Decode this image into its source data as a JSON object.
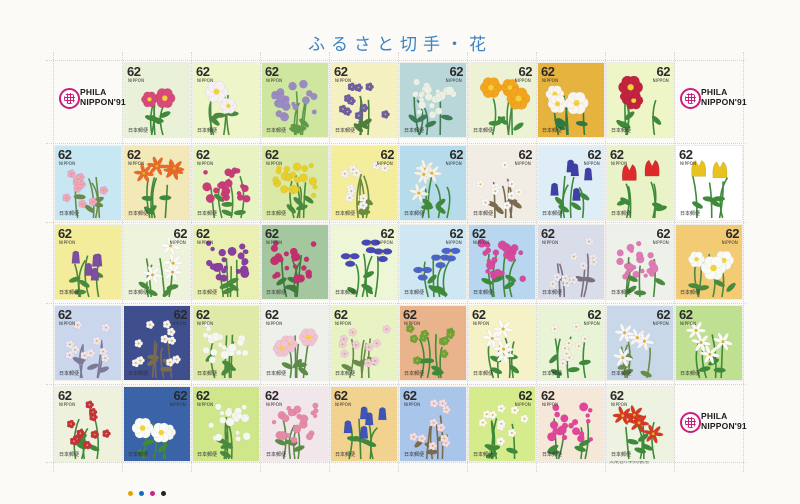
{
  "sheet": {
    "title": "ふるさと切手・花",
    "printer_note": "大蔵省印刷局製造",
    "registration_colors": [
      "#e0a600",
      "#0b6fc9",
      "#d0208a",
      "#222222"
    ]
  },
  "phila_labels": [
    {
      "line1": "PHILA",
      "line2": "NIPPON'91"
    },
    {
      "line1": "PHILA",
      "line2": "NIPPON'91"
    },
    {
      "line1": "PHILA",
      "line2": "NIPPON'91"
    }
  ],
  "stamp_common": {
    "denomination": "62",
    "nippon": "NIPPON",
    "post": "日本郵便"
  },
  "stamps": [
    {
      "bg": "#e9f2d8",
      "flower": "#d94a7b",
      "leaf": "#3f8a3a",
      "kind": "round",
      "dpos": "l"
    },
    {
      "bg": "#eef5c9",
      "flower": "#f6f0f2",
      "leaf": "#4a8a3e",
      "kind": "round",
      "dpos": "l"
    },
    {
      "bg": "#cfe6a0",
      "flower": "#9a8cc2",
      "leaf": "#5e9a48",
      "kind": "cluster",
      "dpos": "l"
    },
    {
      "bg": "#f4f0bf",
      "flower": "#6e5fa8",
      "leaf": "#4d7f3a",
      "kind": "spray",
      "dpos": "l"
    },
    {
      "bg": "#b9d7d8",
      "flower": "#eaf0e4",
      "leaf": "#3f7c53",
      "kind": "cluster",
      "dpos": "r"
    },
    {
      "bg": "#eef2d4",
      "flower": "#f3a51e",
      "leaf": "#3e8e3e",
      "kind": "round",
      "dpos": "r"
    },
    {
      "bg": "#e7b33f",
      "flower": "#fbf5ef",
      "leaf": "#2f7a40",
      "kind": "round",
      "dpos": "l"
    },
    {
      "bg": "#eef6c8",
      "flower": "#c4233e",
      "leaf": "#3f8a3a",
      "kind": "round",
      "dpos": "r"
    },
    {
      "bg": "#c7e7f2",
      "flower": "#f1a8c2",
      "leaf": "#6a8c4a",
      "kind": "spray",
      "dpos": "l"
    },
    {
      "bg": "#f3e8b7",
      "flower": "#ea6a2a",
      "leaf": "#3f8a3a",
      "kind": "star",
      "dpos": "l"
    },
    {
      "bg": "#e8f3c4",
      "flower": "#c93c78",
      "leaf": "#4a8a3e",
      "kind": "cluster",
      "dpos": "l"
    },
    {
      "bg": "#dbe9a6",
      "flower": "#e8cf2c",
      "leaf": "#4a8a3e",
      "kind": "cluster",
      "dpos": "l"
    },
    {
      "bg": "#f4ee9c",
      "flower": "#f7f4f6",
      "leaf": "#6b8a3e",
      "kind": "spray",
      "dpos": "r"
    },
    {
      "bg": "#b6dbeb",
      "flower": "#f3f2e8",
      "leaf": "#3f8a3a",
      "kind": "star",
      "dpos": "r"
    },
    {
      "bg": "#f1ece4",
      "flower": "#fbf8f8",
      "leaf": "#7a6a50",
      "kind": "spray",
      "dpos": "r"
    },
    {
      "bg": "#dfeef6",
      "flower": "#3e3fa8",
      "leaf": "#3f8a3a",
      "kind": "bell",
      "dpos": "r"
    },
    {
      "bg": "#eaf3c8",
      "flower": "#de2a2a",
      "leaf": "#3f8a3a",
      "kind": "tulip",
      "dpos": "l"
    },
    {
      "bg": "#ffffff",
      "flower": "#e8c21e",
      "leaf": "#3f8a3a",
      "kind": "tulip",
      "dpos": "l"
    },
    {
      "bg": "#f3ec9b",
      "flower": "#7c4fa2",
      "leaf": "#4a8a3e",
      "kind": "bell",
      "dpos": "l"
    },
    {
      "bg": "#eef4dc",
      "flower": "#fbfbf6",
      "leaf": "#4a8a3e",
      "kind": "star",
      "dpos": "r"
    },
    {
      "bg": "#eaf0b2",
      "flower": "#8a3fa0",
      "leaf": "#4a8a3e",
      "kind": "cluster",
      "dpos": "l"
    },
    {
      "bg": "#a5c7a0",
      "flower": "#c4306e",
      "leaf": "#3f7a3a",
      "kind": "cluster",
      "dpos": "l"
    },
    {
      "bg": "#edf6d7",
      "flower": "#4748b8",
      "leaf": "#3f8a3a",
      "kind": "iris",
      "dpos": "r"
    },
    {
      "bg": "#cfe7f3",
      "flower": "#4a64c8",
      "leaf": "#3f8a3a",
      "kind": "iris",
      "dpos": "r"
    },
    {
      "bg": "#b8d7ef",
      "flower": "#d64a9c",
      "leaf": "#3f8a3a",
      "kind": "cluster",
      "dpos": "l"
    },
    {
      "bg": "#d9dde9",
      "flower": "#eeeaf1",
      "leaf": "#7c6f80",
      "kind": "spray",
      "dpos": "l"
    },
    {
      "bg": "#eef0ea",
      "flower": "#e07ab3",
      "leaf": "#4a8a3e",
      "kind": "cluster",
      "dpos": "r"
    },
    {
      "bg": "#f3cb74",
      "flower": "#fbfbf6",
      "leaf": "#4a8a3e",
      "kind": "round",
      "dpos": "r"
    },
    {
      "bg": "#cad6ec",
      "flower": "#f1e7f1",
      "leaf": "#7c7a9a",
      "kind": "spray",
      "dpos": "l"
    },
    {
      "bg": "#3f4f8e",
      "flower": "#f7f4f6",
      "leaf": "#7a6a50",
      "kind": "spray",
      "dpos": "r"
    },
    {
      "bg": "#dfe9a8",
      "flower": "#f6f7f0",
      "leaf": "#4a8a3e",
      "kind": "cluster",
      "dpos": "l"
    },
    {
      "bg": "#eef1ea",
      "flower": "#f4c3d3",
      "leaf": "#5e8a48",
      "kind": "round",
      "dpos": "l"
    },
    {
      "bg": "#e8f3c4",
      "flower": "#f3cede",
      "leaf": "#6a8c4a",
      "kind": "spray",
      "dpos": "l"
    },
    {
      "bg": "#e9b48b",
      "flower": "#6fa63a",
      "leaf": "#3f8a3a",
      "kind": "spray",
      "dpos": "l"
    },
    {
      "bg": "#f6f2c8",
      "flower": "#fbfbf6",
      "leaf": "#3f8a3a",
      "kind": "star",
      "dpos": "l"
    },
    {
      "bg": "#e9f4d6",
      "flower": "#f7f5ea",
      "leaf": "#3f8a3a",
      "kind": "spray",
      "dpos": "r"
    },
    {
      "bg": "#c8d8e9",
      "flower": "#f6f6f8",
      "leaf": "#6a8c4a",
      "kind": "star",
      "dpos": "r"
    },
    {
      "bg": "#bfe090",
      "flower": "#fbfbf6",
      "leaf": "#3f8a3a",
      "kind": "star",
      "dpos": "l"
    },
    {
      "bg": "#eef2dc",
      "flower": "#c9333e",
      "leaf": "#3f8a3a",
      "kind": "spray",
      "dpos": "l"
    },
    {
      "bg": "#3b64a8",
      "flower": "#fbfbf6",
      "leaf": "#3f8a3a",
      "kind": "round",
      "dpos": "r"
    },
    {
      "bg": "#cfe68a",
      "flower": "#f6f7f0",
      "leaf": "#4a8a3e",
      "kind": "cluster",
      "dpos": "l"
    },
    {
      "bg": "#f1e7ea",
      "flower": "#e58aa7",
      "leaf": "#5e8a48",
      "kind": "cluster",
      "dpos": "l"
    },
    {
      "bg": "#f2d28f",
      "flower": "#3e54b8",
      "leaf": "#3f8a3a",
      "kind": "bell",
      "dpos": "l"
    },
    {
      "bg": "#a9c5ea",
      "flower": "#f5dee6",
      "leaf": "#7a6a50",
      "kind": "spray",
      "dpos": "l"
    },
    {
      "bg": "#d6ec8c",
      "flower": "#fbfbf6",
      "leaf": "#3f8a3a",
      "kind": "spray",
      "dpos": "r"
    },
    {
      "bg": "#f5e8d9",
      "flower": "#e0479a",
      "leaf": "#3f8a3a",
      "kind": "cluster",
      "dpos": "l"
    },
    {
      "bg": "#eef2e0",
      "flower": "#d73a22",
      "leaf": "#3f8a3a",
      "kind": "star",
      "dpos": "l"
    }
  ]
}
